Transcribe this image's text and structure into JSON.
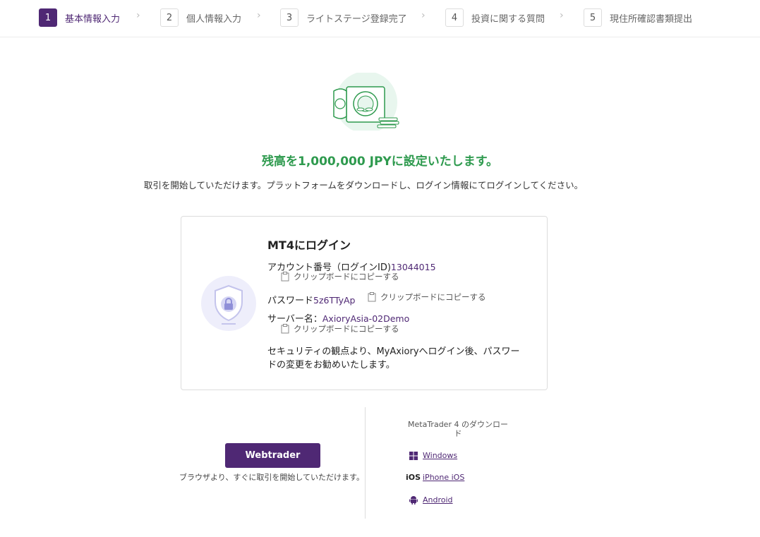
{
  "stepper": {
    "steps": [
      {
        "num": "1",
        "label": "基本情報入力"
      },
      {
        "num": "2",
        "label": "個人情報入力"
      },
      {
        "num": "3",
        "label": "ライトステージ登録完了"
      },
      {
        "num": "4",
        "label": "投資に関する質問"
      },
      {
        "num": "5",
        "label": "現住所確認書類提出"
      }
    ],
    "active_step": 1
  },
  "main": {
    "headline": "残高を1,000,000 JPYに設定いたします。",
    "subline": "取引を開始していただけます。プラットフォームをダウンロードし、ログイン情報にてログインしてください。"
  },
  "login_card": {
    "title": "MT4にログイン",
    "account_label": "アカウント番号（ログインID)",
    "account_value": "13044015",
    "password_label": "パスワード",
    "password_value": "5z6TTyAp",
    "server_label": "サーバー名：",
    "server_value": "AxioryAsia-02Demo",
    "copy_label": "クリップボードにコピーする",
    "note": "セキュリティの観点より、MyAxioryへログイン後、パスワードの変更をお勧めいたします。"
  },
  "webtrader": {
    "button_label": "Webtrader",
    "note": "ブラウザより、すぐに取引を開始していただけます。"
  },
  "downloads": {
    "title": "MetaTrader 4 のダウンロード",
    "items": [
      {
        "icon": "windows-icon",
        "icon_text": "",
        "label": "Windows"
      },
      {
        "icon": "ios-icon",
        "icon_text": "iOS",
        "label": "iPhone iOS"
      },
      {
        "icon": "android-icon",
        "icon_text": "",
        "label": "Android"
      }
    ]
  },
  "colors": {
    "brand": "#4f2874",
    "success": "#2e9a4e"
  }
}
